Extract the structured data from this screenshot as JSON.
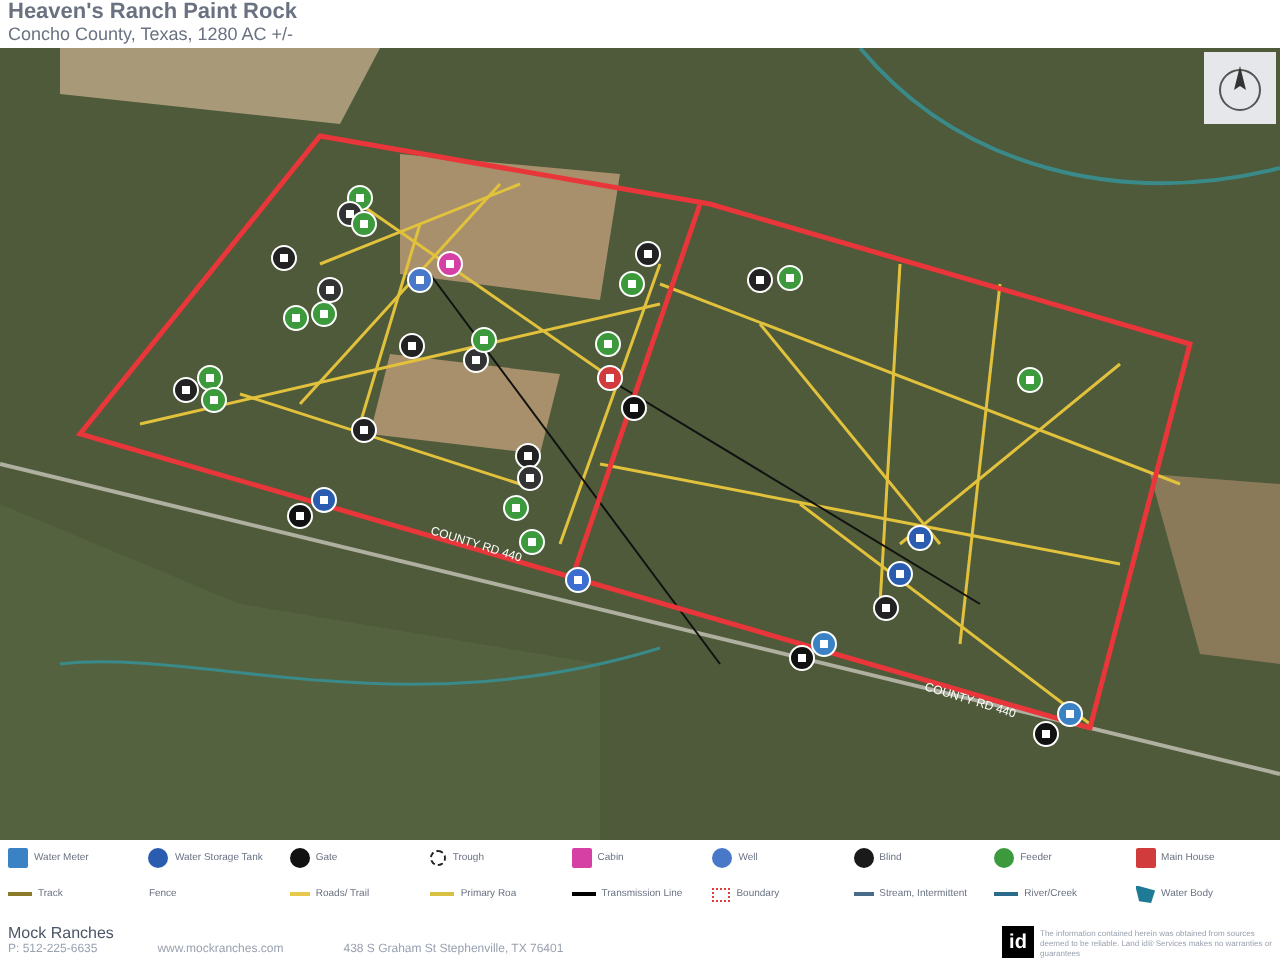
{
  "header": {
    "title": "Heaven's Ranch Paint Rock",
    "subtitle": "Concho County, Texas, 1280 AC +/-"
  },
  "map": {
    "road_labels": [
      "COUNTY RD 440",
      "COUNTY RD 440"
    ]
  },
  "legend": [
    {
      "label": "Water Meter",
      "kind": "square",
      "color": "#3b82c4"
    },
    {
      "label": "Water Storage Tank",
      "kind": "circle",
      "color": "#2a5db0"
    },
    {
      "label": "Gate",
      "kind": "circle",
      "color": "#111111"
    },
    {
      "label": "Trough",
      "kind": "ring",
      "color": "#222222"
    },
    {
      "label": "Cabin",
      "kind": "square",
      "color": "#d63fa3"
    },
    {
      "label": "Well",
      "kind": "circle",
      "color": "#4a78c8"
    },
    {
      "label": "Blind",
      "kind": "circle",
      "color": "#1a1a1a"
    },
    {
      "label": "Feeder",
      "kind": "circle",
      "color": "#3c9a3c"
    },
    {
      "label": "Main House",
      "kind": "square",
      "color": "#d23b3b"
    },
    {
      "label": "Track",
      "kind": "line",
      "color": "#8a7a2a"
    },
    {
      "label": "Fence",
      "kind": "none"
    },
    {
      "label": "Roads/ Trail",
      "kind": "dash",
      "color": "#e8c84a"
    },
    {
      "label": "Primary Roa",
      "kind": "line",
      "color": "#d8c040"
    },
    {
      "label": "Transmission Line",
      "kind": "line",
      "color": "#000000"
    },
    {
      "label": "Boundary",
      "kind": "boundary",
      "color": "#e23b3b"
    },
    {
      "label": "Stream, Intermittent",
      "kind": "dash",
      "color": "#4a6a8a"
    },
    {
      "label": "River/Creek",
      "kind": "line",
      "color": "#2a6a8a"
    },
    {
      "label": "Water Body",
      "kind": "area",
      "color": "#1f7a96"
    }
  ],
  "footer": {
    "company": "Mock Ranches",
    "phone": "P: 512-225-6635",
    "website": "www.mockranches.com",
    "address": "438 S Graham St Stephenville, TX 76401",
    "logo_text": "id",
    "disclaimer": "The information contained herein was obtained from sources deemed to be reliable. Land id® Services makes no warranties or guarantees"
  }
}
